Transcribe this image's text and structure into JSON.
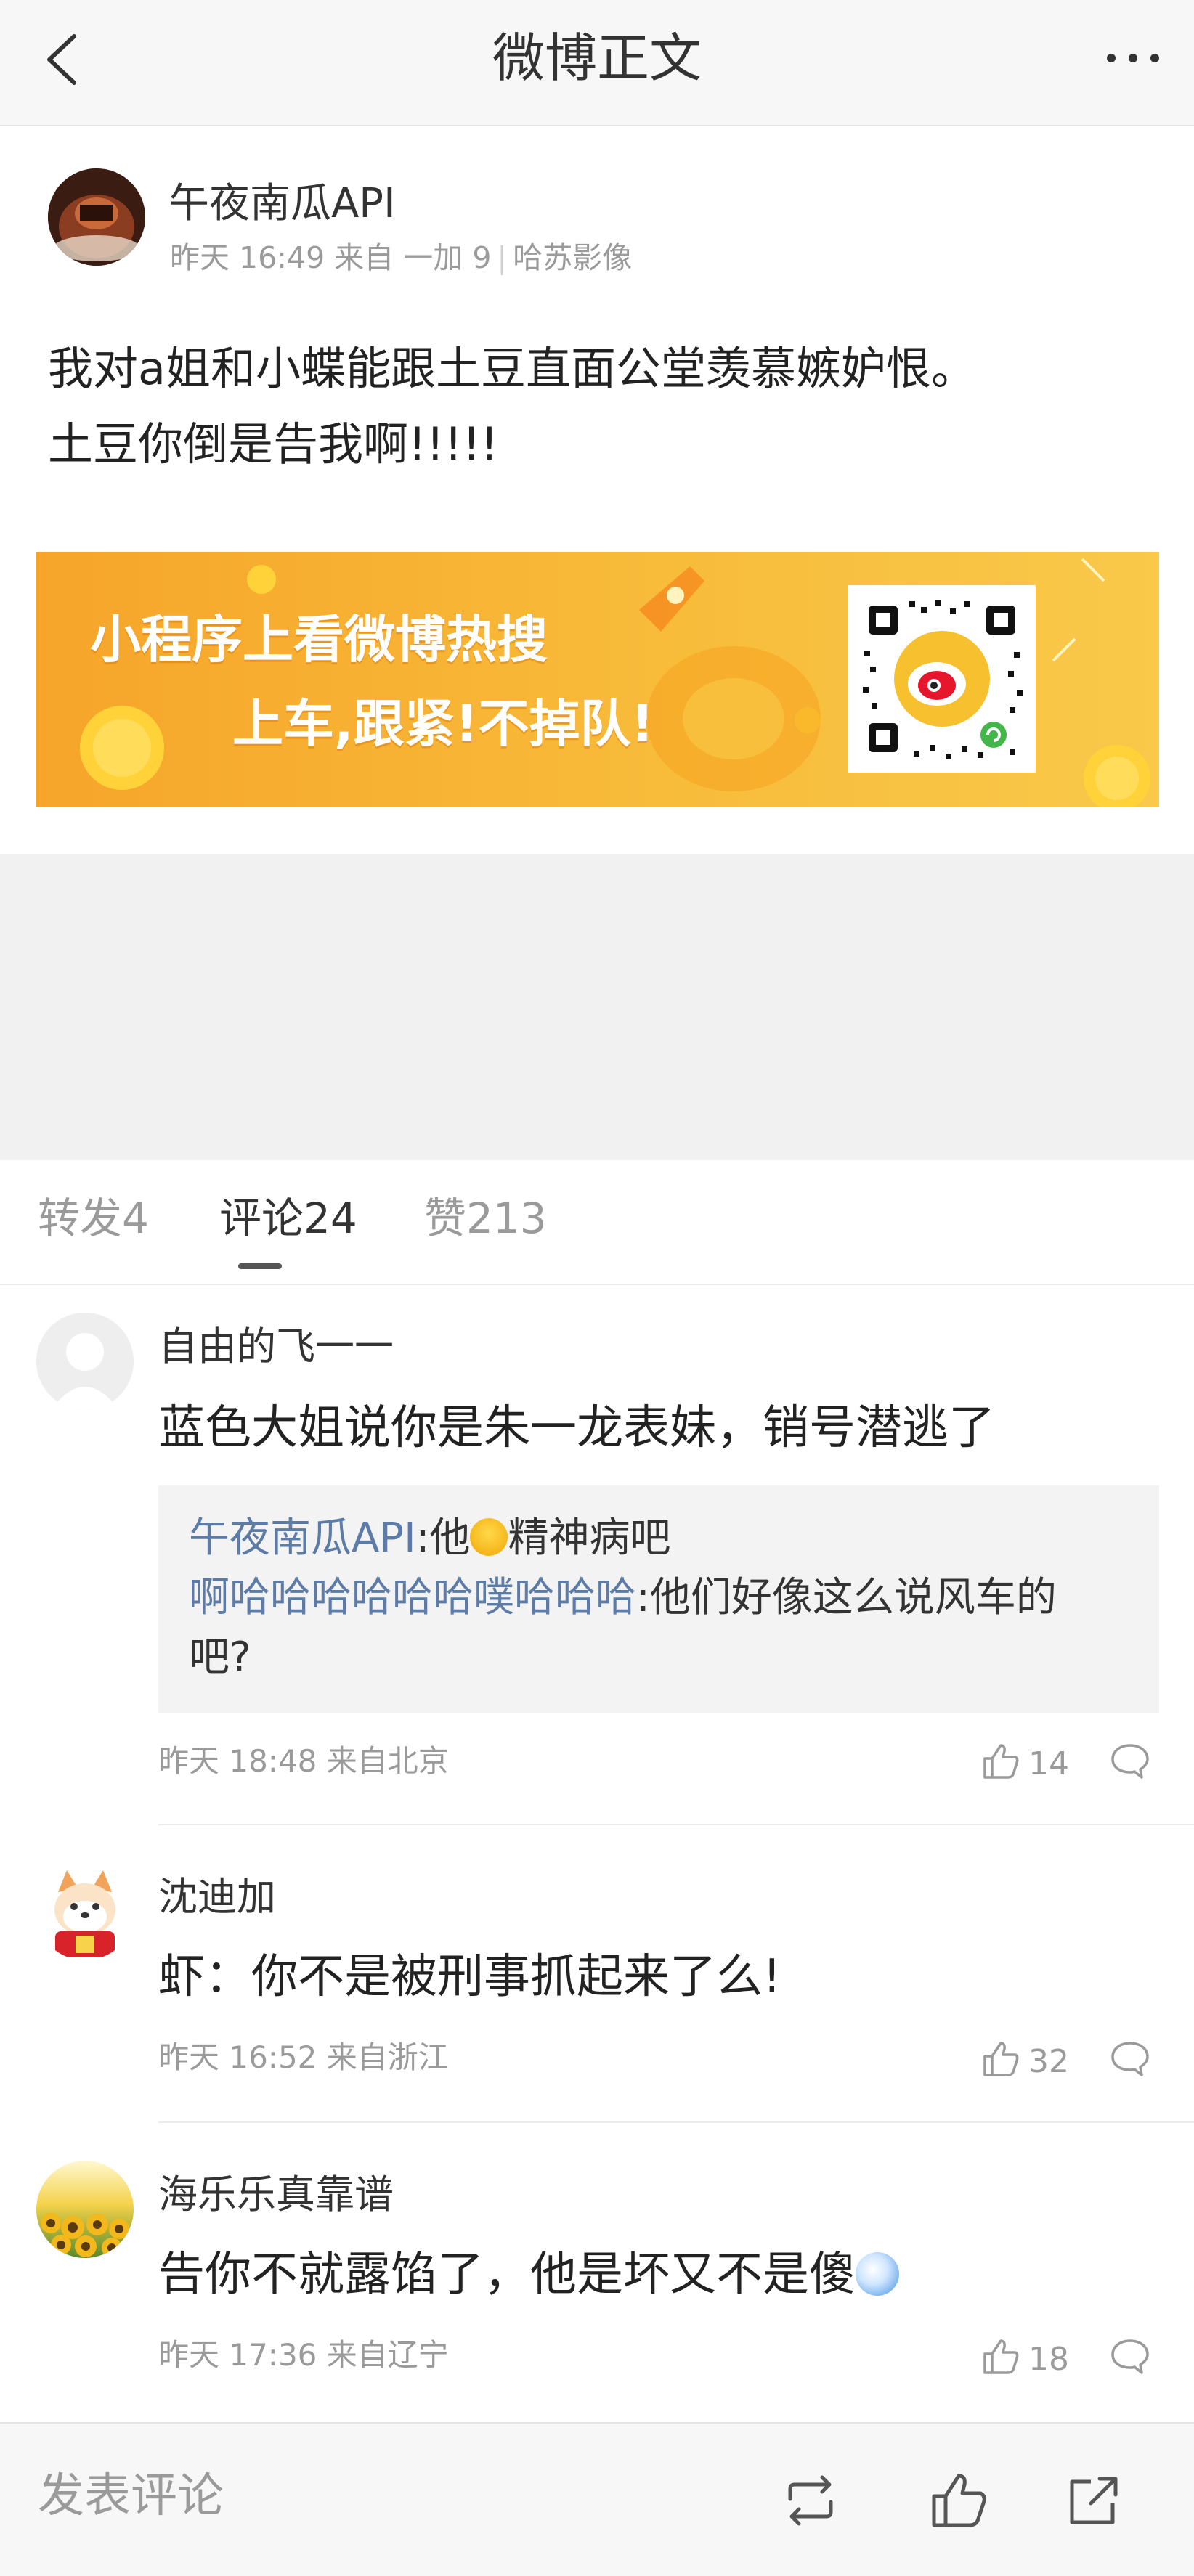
{
  "nav": {
    "title": "微博正文"
  },
  "post": {
    "author": "午夜南瓜API",
    "time": "昨天 16:49",
    "source": "来自 一加 9",
    "lens": "哈苏影像",
    "text": "我对a姐和小蝶能跟土豆直面公堂羡慕嫉妒恨。\n土豆你倒是告我啊!!!!!"
  },
  "banner": {
    "line1": "小程序上看微博热搜",
    "line2": "上车,跟紧!不掉队!"
  },
  "tabs": [
    {
      "label": "转发4"
    },
    {
      "label": "评论24"
    },
    {
      "label": "赞213"
    }
  ],
  "comments": [
    {
      "user": "自由的飞一一",
      "text": "蓝色大姐说你是朱一龙表妹，销号潜逃了",
      "meta": "昨天 18:48 来自北京",
      "likes": "14",
      "replies": [
        {
          "user": "午夜南瓜API",
          "sep": ":",
          "before_emoji": "他",
          "emoji": "laugh-cry-emoji",
          "after_emoji": "精神病吧"
        },
        {
          "user": "啊哈哈哈哈哈哈噗哈哈哈",
          "sep": ":",
          "text1": "他们好像这么说风车的",
          "text2": "吧?"
        }
      ]
    },
    {
      "user": "沈迪加",
      "text": "虾：你不是被刑事抓起来了么!",
      "meta": "昨天 16:52 来自浙江",
      "likes": "32"
    },
    {
      "user": "海乐乐真靠谱",
      "text": "告你不就露馅了，他是坏又不是傻",
      "emoji": "doge-emoji",
      "meta": "昨天 17:36 来自辽宁",
      "likes": "18"
    }
  ],
  "bottom": {
    "placeholder": "发表评论"
  },
  "colors": {
    "link": "#5d7ba7",
    "banner": "#f8bb3a",
    "text": "#333333",
    "meta": "#9a9a9a"
  }
}
